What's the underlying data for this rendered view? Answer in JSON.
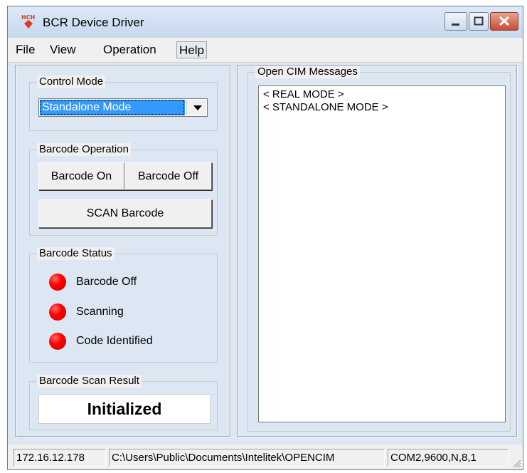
{
  "window": {
    "title": "BCR Device Driver",
    "app_icon_text": "HCH"
  },
  "menu": {
    "items": [
      "File",
      "View",
      "Operation",
      "Help"
    ]
  },
  "control_mode": {
    "label": "Control Mode",
    "selected": "Standalone Mode"
  },
  "barcode_operation": {
    "label": "Barcode Operation",
    "on_button": "Barcode On",
    "off_button": "Barcode Off",
    "scan_button": "SCAN Barcode"
  },
  "barcode_status": {
    "label": "Barcode Status",
    "items": [
      "Barcode Off",
      "Scanning",
      "Code Identified"
    ]
  },
  "scan_result": {
    "label": "Barcode Scan Result",
    "value": "Initialized"
  },
  "messages": {
    "label": "Open CIM Messages",
    "lines": [
      "< REAL MODE >",
      "< STANDALONE MODE >"
    ]
  },
  "status_bar": {
    "ip": "172.16.12.178",
    "path": "C:\\Users\\Public\\Documents\\Intelitek\\OPENCIM",
    "port": "COM2,9600,N,8,1"
  },
  "colors": {
    "led_off": "#ff0000",
    "selection": "#3399ff",
    "close_button": "#c94a32"
  }
}
